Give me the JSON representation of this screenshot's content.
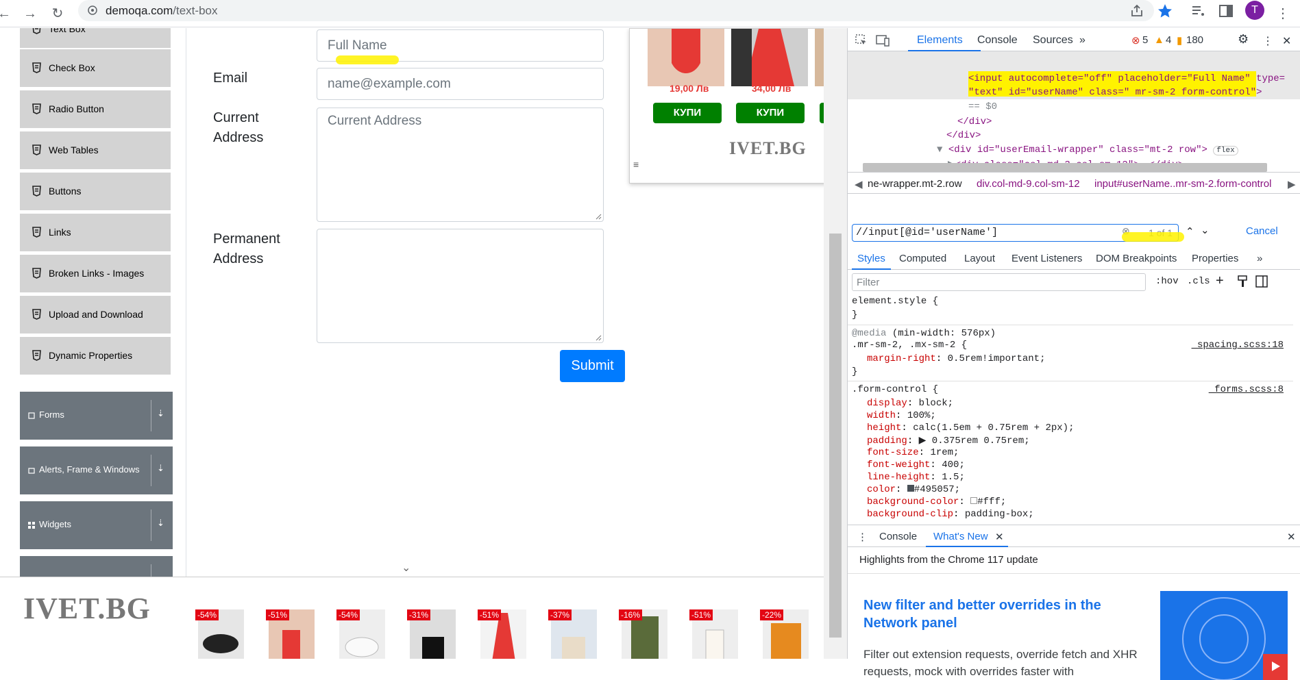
{
  "browser": {
    "url_host": "demoqa.com",
    "url_path": "/text-box",
    "avatar_letter": "T"
  },
  "sidebar": {
    "items": [
      {
        "label": "Text Box"
      },
      {
        "label": "Check Box"
      },
      {
        "label": "Radio Button"
      },
      {
        "label": "Web Tables"
      },
      {
        "label": "Buttons"
      },
      {
        "label": "Links"
      },
      {
        "label": "Broken Links - Images"
      },
      {
        "label": "Upload and Download"
      },
      {
        "label": "Dynamic Properties"
      }
    ],
    "groups": [
      {
        "label": "Forms"
      },
      {
        "label": "Alerts, Frame & Windows"
      },
      {
        "label": "Widgets"
      }
    ]
  },
  "form": {
    "fullname_placeholder": "Full Name",
    "email_label": "Email",
    "email_placeholder": "name@example.com",
    "current_label_1": "Current",
    "current_label_2": "Address",
    "current_placeholder": "Current Address",
    "permanent_label_1": "Permanent",
    "permanent_label_2": "Address",
    "submit_label": "Submit"
  },
  "ad": {
    "prices": [
      "19,00 Лв",
      "34,00 Лв"
    ],
    "buy_label": "КУПИ",
    "logo": "IVET.BG"
  },
  "banner": {
    "logo": "IVET.BG",
    "discounts": [
      "-54%",
      "-51%",
      "-54%",
      "-31%",
      "-51%",
      "-37%",
      "-16%",
      "-51%",
      "-22%"
    ]
  },
  "devtools": {
    "tabs": [
      "Elements",
      "Console",
      "Sources"
    ],
    "errors": "5",
    "warnings": "4",
    "infos": "180",
    "dom": {
      "line1": "<input autocomplete=\"off\" placeholder=\"Full Name\" type=",
      "line2": "\"text\" id=\"userName\" class=\" mr-sm-2 form-control\">",
      "line3": "== $0",
      "line4": "</div>",
      "line5": "</div>",
      "line6": "<div id=\"userEmail-wrapper\" class=\"mt-2 row\">",
      "line6_badge": "flex",
      "line7": "<div class=\"col-md-3 col-sm-12\">",
      "line7_end": "</div>"
    },
    "crumbs": [
      "ne-wrapper.mt-2.row",
      "div.col-md-9.col-sm-12",
      "input#userName..mr-sm-2.form-control"
    ],
    "search_value": "//input[@id='userName']",
    "search_count": "1 of 1",
    "search_cancel": "Cancel",
    "style_tabs": [
      "Styles",
      "Computed",
      "Layout",
      "Event Listeners",
      "DOM Breakpoints",
      "Properties"
    ],
    "filter_placeholder": "Filter",
    "hov": ":hov",
    "cls": ".cls",
    "rules": {
      "element_style": "element.style {",
      "close": "}",
      "media_kw": "@media",
      "media_q": "(min-width: 576px)",
      "rule1_sel": ".mr-sm-2, .mx-sm-2 {",
      "rule1_src": "_spacing.scss:18",
      "rule1_prop": "margin-right",
      "rule1_val": "0.5rem!important;",
      "rule2_sel": ".form-control {",
      "rule2_src": "_forms.scss:8",
      "props": [
        {
          "p": "display",
          "v": "block;"
        },
        {
          "p": "width",
          "v": "100%;"
        },
        {
          "p": "height",
          "v": "calc(1.5em + 0.75rem + 2px);"
        },
        {
          "p": "padding",
          "v": "▶ 0.375rem 0.75rem;"
        },
        {
          "p": "font-size",
          "v": "1rem;"
        },
        {
          "p": "font-weight",
          "v": "400;"
        },
        {
          "p": "line-height",
          "v": "1.5;"
        },
        {
          "p": "color",
          "v": "#495057;"
        },
        {
          "p": "background-color",
          "v": "#fff;"
        },
        {
          "p": "background-clip",
          "v": "padding-box;"
        }
      ]
    },
    "drawer": {
      "tabs": [
        "Console",
        "What's New"
      ],
      "heading": "Highlights from the Chrome 117 update",
      "title": "New filter and better overrides in the Network panel",
      "body": "Filter out extension requests, override fetch and XHR requests, mock with overrides faster with"
    }
  }
}
